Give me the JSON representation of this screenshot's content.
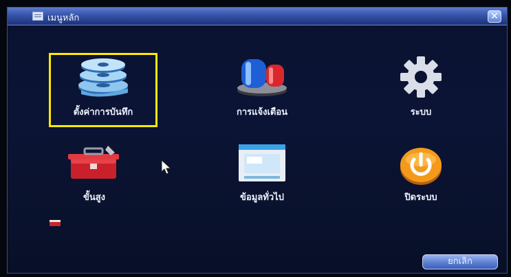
{
  "window": {
    "title": "เมนูหลัก",
    "close_glyph": "✕"
  },
  "menu": {
    "items": [
      {
        "label": "ตั้งค่าการบันทึก",
        "icon": "film-reels-icon",
        "selected": true
      },
      {
        "label": "การแจ้งเตือน",
        "icon": "siren-icon",
        "selected": false
      },
      {
        "label": "ระบบ",
        "icon": "gear-icon",
        "selected": false
      },
      {
        "label": "ขั้นสูง",
        "icon": "toolbox-icon",
        "selected": false
      },
      {
        "label": "ข้อมูลทั่วไป",
        "icon": "info-window-icon",
        "selected": false
      },
      {
        "label": "ปิดระบบ",
        "icon": "power-icon",
        "selected": false
      }
    ]
  },
  "footer": {
    "cancel_label": "ยกเลิก"
  },
  "colors": {
    "selection": "#ffea00",
    "background": "#0a1230",
    "titlebar": "#3554a8"
  }
}
